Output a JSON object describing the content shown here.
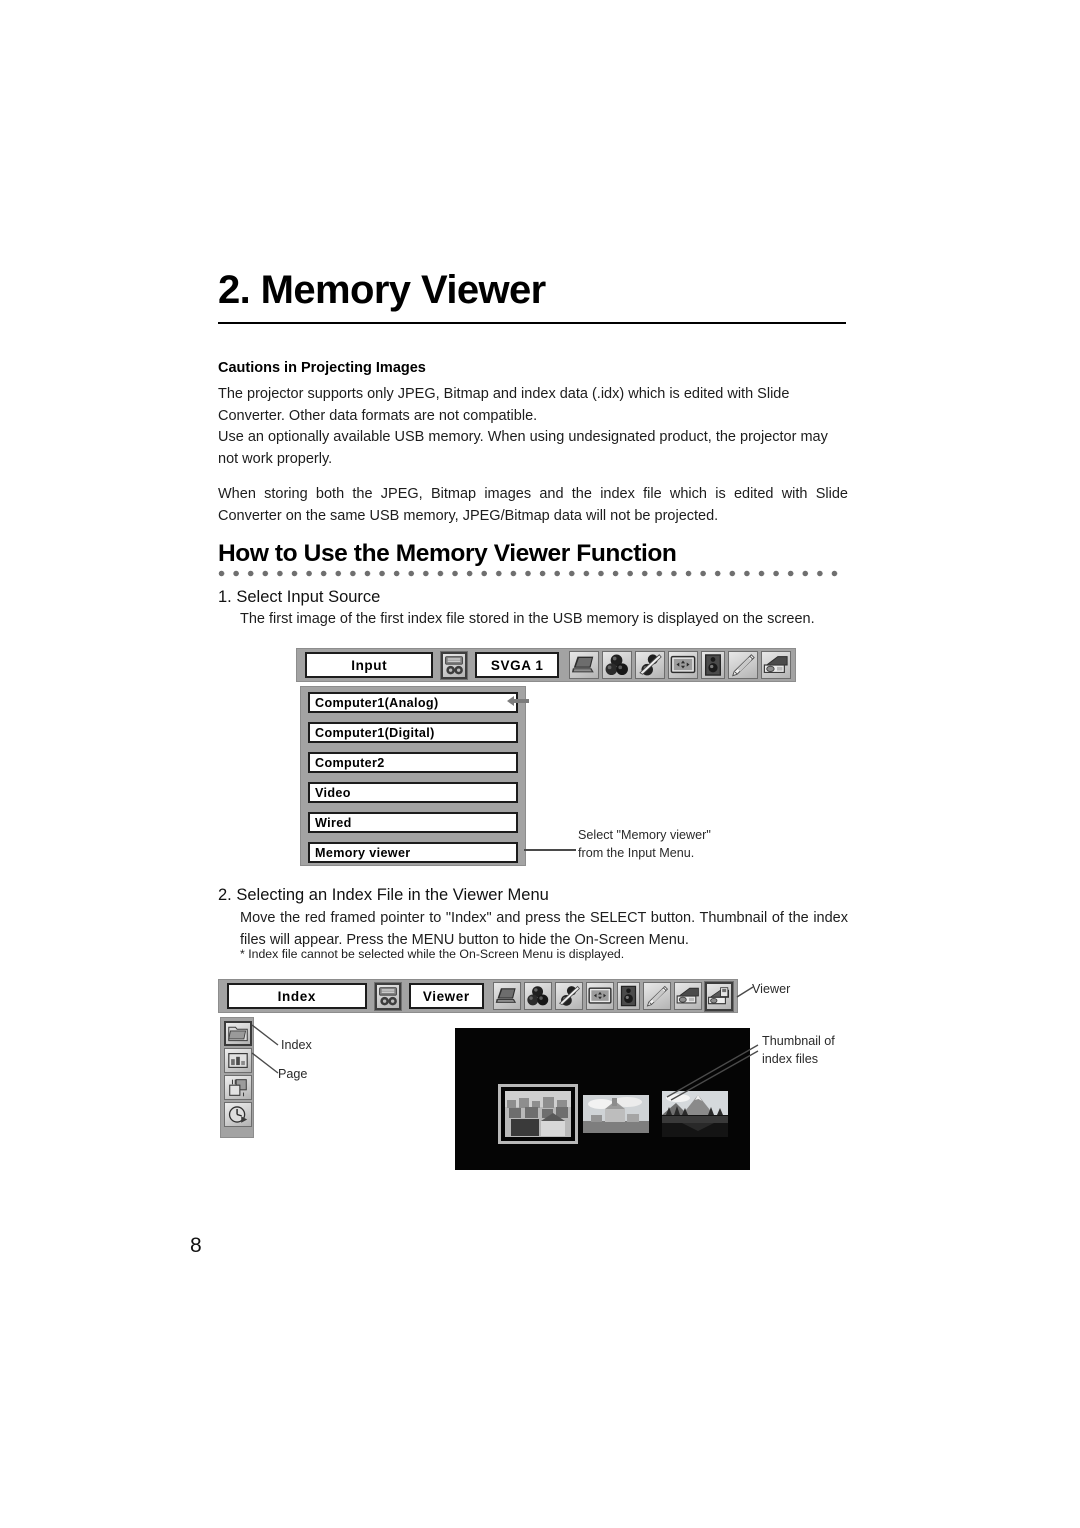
{
  "chapter": {
    "title": "2. Memory Viewer"
  },
  "cautions": {
    "heading": "Cautions in Projecting Images",
    "paragraph1": "The projector supports only JPEG, Bitmap and index data (.idx) which is edited with Slide Converter.  Other data formats are not compatible.",
    "paragraph2": "Use an optionally available USB memory.  When using undesignated product, the projector may not work properly.",
    "paragraph3": "When storing both the JPEG, Bitmap images and the index file which is edited with Slide Converter on the same USB memory, JPEG/Bitmap data will not be projected."
  },
  "section": {
    "title": "How to Use the Memory Viewer Function"
  },
  "step1": {
    "heading": "1. Select Input Source",
    "body": "The first image of the first index file stored in the USB memory is displayed on the screen.",
    "menu": {
      "title_field": "Input",
      "mode_field": "SVGA  1",
      "system_icon": "system-icon",
      "icons": [
        "computer-icon",
        "color-adjust-icon",
        "image-adjust-icon",
        "screen-icon",
        "sound-icon",
        "setting-icon",
        "network-icon"
      ],
      "items": [
        "Computer1(Analog)",
        "Computer1(Digital)",
        "Computer2",
        "Video",
        "Wired",
        "Memory viewer"
      ]
    },
    "callout": {
      "line1": "Select \"Memory viewer\"",
      "line2": "from the Input Menu."
    }
  },
  "step2": {
    "heading": "2. Selecting an Index File in the Viewer Menu",
    "body": "Move the red framed pointer to \"Index\" and press the SELECT button.  Thumbnail of the index files will appear.  Press the MENU button to hide the On-Screen Menu.",
    "footnote": "* Index file cannot be selected while the On-Screen Menu is displayed.",
    "menu": {
      "title_field": "Index",
      "mode_field": "Viewer",
      "system_icon": "system-icon",
      "icons": [
        "computer-icon",
        "color-adjust-icon",
        "image-adjust-icon",
        "screen-icon",
        "sound-icon",
        "setting-icon",
        "network-icon",
        "viewer-icon"
      ],
      "selected_icon_index": 7
    },
    "sidebar": [
      {
        "name": "index-icon",
        "label": "Index"
      },
      {
        "name": "page-icon",
        "label": "Page"
      },
      {
        "name": "slide-transition-icon",
        "label": ""
      },
      {
        "name": "timer-icon",
        "label": ""
      }
    ],
    "callouts": {
      "viewer": "Viewer",
      "thumbnail_line1": "Thumbnail of",
      "thumbnail_line2": "index files"
    },
    "thumbnails": [
      {
        "name": "thumbnail-village",
        "selected": true
      },
      {
        "name": "thumbnail-castle",
        "selected": false
      },
      {
        "name": "thumbnail-mountain",
        "selected": false
      }
    ]
  },
  "footer": {
    "page_number": "8"
  },
  "colors": {
    "osd_background": "#a3a3a3",
    "osd_field": "#ffffff",
    "screen": "#050505",
    "text": "#1a1a1a"
  }
}
